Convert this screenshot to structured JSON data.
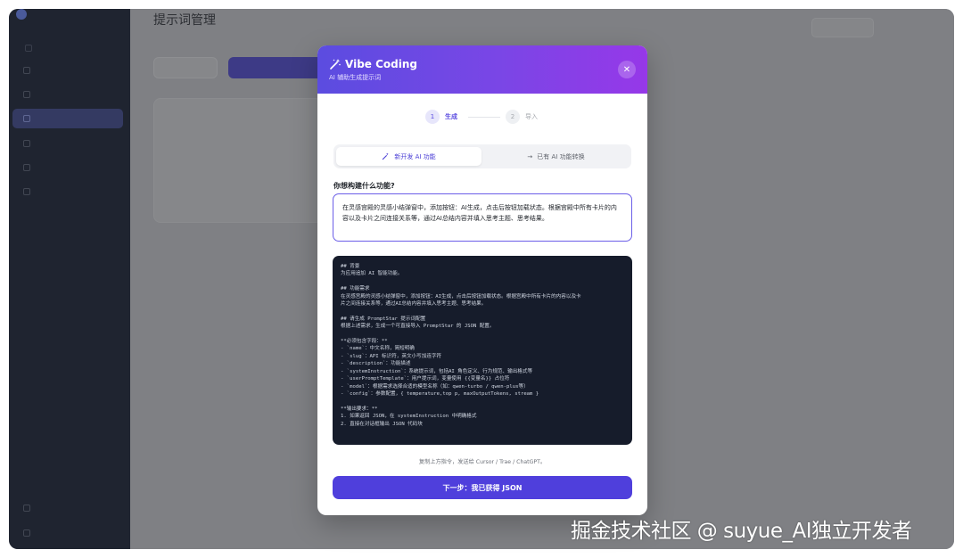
{
  "colors": {
    "accent": "#5b4ce0",
    "header_gradient_end": "#9638e8",
    "code_bg": "#161c2b",
    "primary_button": "#4f3fdc"
  },
  "sidebar": {
    "logo_text": "",
    "items": [
      {
        "label": "",
        "icon": "grid-icon"
      },
      {
        "label": "",
        "icon": "list-icon"
      },
      {
        "label": "",
        "icon": "prompt-icon",
        "active": true
      },
      {
        "label": "",
        "icon": "chart-icon"
      },
      {
        "label": "",
        "icon": "folder-icon"
      },
      {
        "label": "",
        "icon": "settings-icon"
      }
    ],
    "bottom_items": [
      {
        "label": "",
        "icon": "user-icon"
      },
      {
        "label": "",
        "icon": "logout-icon"
      }
    ]
  },
  "main": {
    "page_title": "提示词管理",
    "page_subtitle": "",
    "copy_button": "",
    "vibe_button": "",
    "card": {
      "tag": "",
      "title": "",
      "desc": ""
    },
    "lang_button": "",
    "user_button": ""
  },
  "modal": {
    "title": "Vibe Coding",
    "subtitle": "AI 辅助生成提示词",
    "close_icon": "close-icon",
    "steps": [
      {
        "number": "1",
        "label": "生成",
        "active": true
      },
      {
        "number": "2",
        "label": "导入",
        "active": false
      }
    ],
    "toggle": {
      "option_new": "新开发 AI 功能",
      "option_existing": "已有 AI 功能转换"
    },
    "question_label": "你想构建什么功能?",
    "question_value": "在灵感宫殿的灵感小结弹窗中，添加按钮：AI生成，点击后按钮加载状态。根据宫殿中所有卡片的内容以及卡片之间连接关系等，通过AI总结内容并填入思考主题、思考结果。",
    "code": "## 背景\n为应用追加 AI 智能功能。\n\n## 功能需求\n在灵感宫殿的灵感小结弹窗中，添加按钮：AI生成，点击后按钮加载状态。根据宫殿中所有卡片的内容以及卡\n片之间连接关系等，通过AI总结内容并填入思考主题、思考结果。\n\n## 请生成 PromptStar 提示词配置\n根据上述需求，生成一个可直接导入 PromptStar 的 JSON 配置。\n\n**必须包含字段：**\n- `name`：中文名称，简短明确\n- `slug`：API 标识符，英文小写加连字符\n- `description`：功能描述\n- `systemInstruction`：系统提示词，包括AI 角色定义、行为规范、输出格式等\n- `userPromptTemplate`：用户提示词，变量使用 {{变量名}} 占位符\n- `model`：根据需求选择合适的模型名称（如：qwen-turbo / qwen-plus等）\n- `config`：参数配置，{ temperature,top p, maxOutputTokens, stream }\n\n**输出要求：**\n1. 如果返回 JSON，在 systemInstruction 中明确格式\n2. 直接在对话框输出 JSON 代码块",
    "hint": "复制上方指令，发送给 Cursor / Trae / ChatGPT。",
    "next_button": "下一步：我已获得 JSON"
  },
  "watermark": "掘金技术社区 @ suyue_AI独立开发者"
}
